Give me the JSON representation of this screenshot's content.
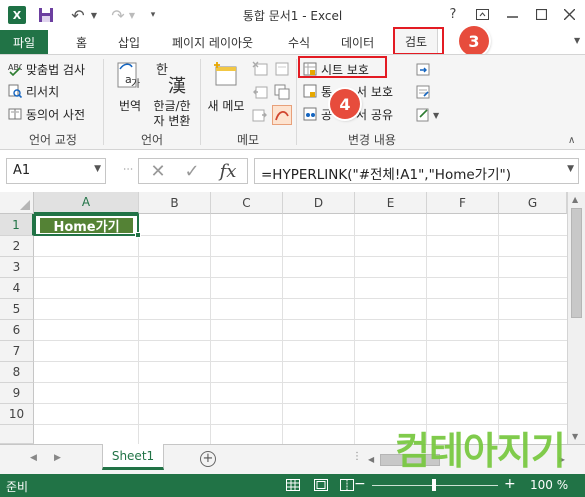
{
  "app": {
    "title": "통합 문서1 - Excel",
    "logo": "X",
    "help": "?",
    "window_buttons": [
      "ribbon-display-icon",
      "minimize-icon",
      "maximize-icon",
      "close-icon"
    ]
  },
  "tabs": {
    "file": "파일",
    "items": [
      "홈",
      "삽입",
      "페이지 레이아웃",
      "수식",
      "데이터"
    ],
    "active": "검토"
  },
  "annotations": {
    "step3": "3",
    "step4": "4"
  },
  "ribbon": {
    "proofing": {
      "label": "언어 교정",
      "spell": "맞춤법 검사",
      "research": "리서치",
      "thesaurus": "동의어 사전"
    },
    "language": {
      "label": "언어",
      "translate": "번역",
      "hanja_top": "한글/한",
      "hanja_bottom": "자 변환",
      "hanja_glyph": "漢",
      "hanja_hangul": "한",
      "translate_glyph": "가"
    },
    "comments": {
      "label": "메모",
      "new_comment_top": "새 메모"
    },
    "changes": {
      "label": "변경 내용",
      "protect_sheet": "시트 보호",
      "protect_workbook_1": "통",
      "protect_workbook_2": "서 보호",
      "share_workbook_1": "공",
      "share_workbook_2": "서 공유"
    }
  },
  "formula_bar": {
    "name_box": "A1",
    "cancel": "✕",
    "enter": "✓",
    "fx": "fx",
    "formula": "=HYPERLINK(\"#전체!A1\",\"Home가기\")"
  },
  "grid": {
    "columns": [
      "A",
      "B",
      "C",
      "D",
      "E",
      "F",
      "G"
    ],
    "rows": [
      "1",
      "2",
      "3",
      "4",
      "5",
      "6",
      "7",
      "8",
      "9",
      "10"
    ],
    "a1_value": "Home가기",
    "a1_fill": "#548235"
  },
  "sheets": {
    "tab": "Sheet1",
    "add": "+"
  },
  "watermark": "컴테아지기",
  "status": {
    "ready": "준비",
    "zoom": "100 %",
    "minus": "−",
    "plus": "+"
  },
  "colors": {
    "accent": "#217346",
    "annotation": "#e31b23"
  }
}
